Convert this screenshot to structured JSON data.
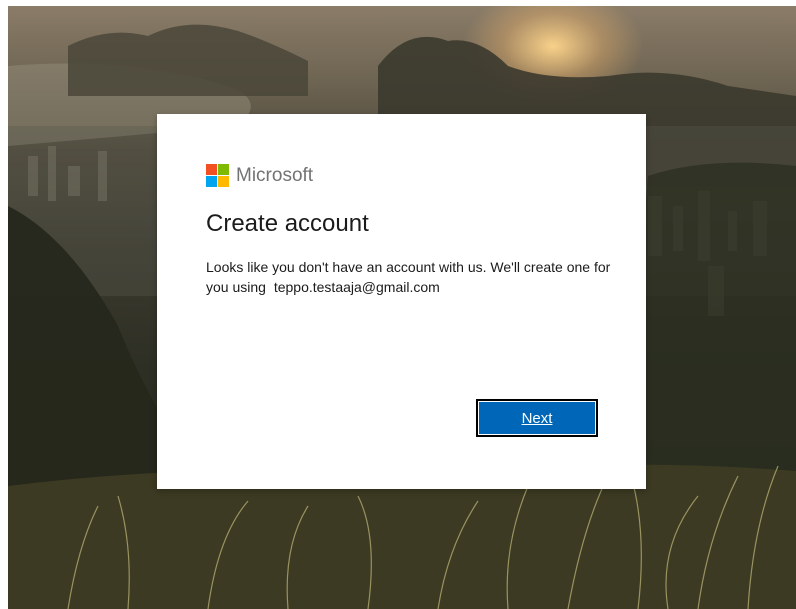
{
  "brand": {
    "logo_text": "Microsoft",
    "logo_colors": [
      "#f25022",
      "#7fba00",
      "#00a4ef",
      "#ffb900"
    ]
  },
  "dialog": {
    "title": "Create account",
    "description": "Looks like you don't have an account with us. We'll create one for you using",
    "email": "teppo.testaaja@gmail.com",
    "next_label": "Next"
  },
  "colors": {
    "accent": "#0067b8",
    "text": "#1b1b1b",
    "logo_text": "#737373"
  },
  "background": {
    "image": "landscape-photo"
  }
}
